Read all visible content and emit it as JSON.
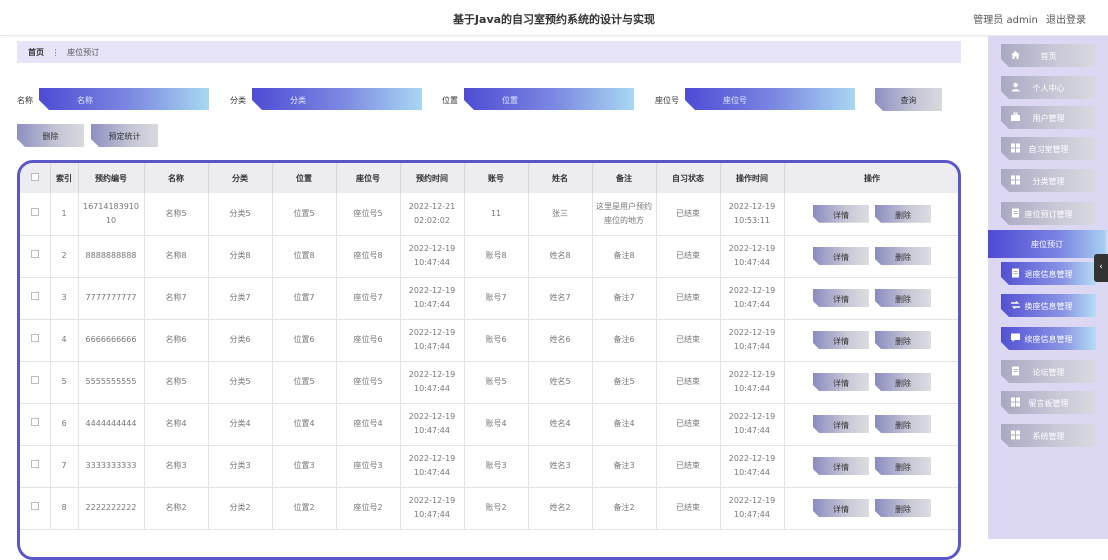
{
  "header": {
    "title": "基于Java的自习室预约系统的设计与实现",
    "user_label": "管理员 admin",
    "logout": "退出登录"
  },
  "breadcrumb": {
    "home": "首页",
    "separator": "⋮",
    "current": "座位预订"
  },
  "search": {
    "fields": [
      {
        "label": "名称",
        "placeholder": "名称"
      },
      {
        "label": "分类",
        "placeholder": "分类"
      },
      {
        "label": "位置",
        "placeholder": "位置"
      },
      {
        "label": "座位号",
        "placeholder": "座位号"
      }
    ],
    "query_button": "查询",
    "delete_button": "删除",
    "stats_button": "预定统计"
  },
  "table": {
    "headers": [
      "",
      "索引",
      "预约编号",
      "名称",
      "分类",
      "位置",
      "座位号",
      "预约时间",
      "账号",
      "姓名",
      "备注",
      "自习状态",
      "操作时间",
      "操作"
    ],
    "rows": [
      [
        "1",
        "16714183910 10",
        "名称5",
        "分类5",
        "位置5",
        "座位号5",
        "2022-12-21 02:02:02",
        "11",
        "张三",
        "这里是用户预约座位的地方",
        "已结束",
        "2022-12-19 10:53:11"
      ],
      [
        "2",
        "8888888888",
        "名称8",
        "分类8",
        "位置8",
        "座位号8",
        "2022-12-19 10:47:44",
        "账号8",
        "姓名8",
        "备注8",
        "已结束",
        "2022-12-19 10:47:44"
      ],
      [
        "3",
        "7777777777",
        "名称7",
        "分类7",
        "位置7",
        "座位号7",
        "2022-12-19 10:47:44",
        "账号7",
        "姓名7",
        "备注7",
        "已结束",
        "2022-12-19 10:47:44"
      ],
      [
        "4",
        "6666666666",
        "名称6",
        "分类6",
        "位置6",
        "座位号6",
        "2022-12-19 10:47:44",
        "账号6",
        "姓名6",
        "备注6",
        "已结束",
        "2022-12-19 10:47:44"
      ],
      [
        "5",
        "5555555555",
        "名称5",
        "分类5",
        "位置5",
        "座位号5",
        "2022-12-19 10:47:44",
        "账号5",
        "姓名5",
        "备注5",
        "已结束",
        "2022-12-19 10:47:44"
      ],
      [
        "6",
        "4444444444",
        "名称4",
        "分类4",
        "位置4",
        "座位号4",
        "2022-12-19 10:47:44",
        "账号4",
        "姓名4",
        "备注4",
        "已结束",
        "2022-12-19 10:47:44"
      ],
      [
        "7",
        "3333333333",
        "名称3",
        "分类3",
        "位置3",
        "座位号3",
        "2022-12-19 10:47:44",
        "账号3",
        "姓名3",
        "备注3",
        "已结束",
        "2022-12-19 10:47:44"
      ],
      [
        "8",
        "2222222222",
        "名称2",
        "分类2",
        "位置2",
        "座位号2",
        "2022-12-19 10:47:44",
        "账号2",
        "姓名2",
        "备注2",
        "已结束",
        "2022-12-19 10:47:44"
      ]
    ],
    "action_detail": "详情",
    "action_delete": "删除"
  },
  "sidebar": {
    "items": [
      {
        "label": "首页",
        "icon": "home-icon"
      },
      {
        "label": "个人中心",
        "icon": "person-icon"
      },
      {
        "label": "用户管理",
        "icon": "briefcase-icon"
      },
      {
        "label": "自习室管理",
        "icon": "grid-icon"
      },
      {
        "label": "分类管理",
        "icon": "grid-icon"
      },
      {
        "label": "座位预订管理",
        "icon": "doc-icon"
      },
      {
        "label": "座位预订",
        "icon": "",
        "active": true
      },
      {
        "label": "退座信息管理",
        "icon": "doc-icon",
        "sub": true
      },
      {
        "label": "换座信息管理",
        "icon": "arrows-icon",
        "sub": true
      },
      {
        "label": "续座信息管理",
        "icon": "chat-icon",
        "sub": true
      },
      {
        "label": "论坛管理",
        "icon": "doc-icon"
      },
      {
        "label": "留言板管理",
        "icon": "grid-icon"
      },
      {
        "label": "系统管理",
        "icon": "grid-icon"
      }
    ],
    "collapse_glyph": "‹"
  },
  "colors": {
    "accent": "#5c57c8",
    "sidebar_bg": "#dcd7f3",
    "breadcrumb_bg": "#e7e4fa"
  }
}
